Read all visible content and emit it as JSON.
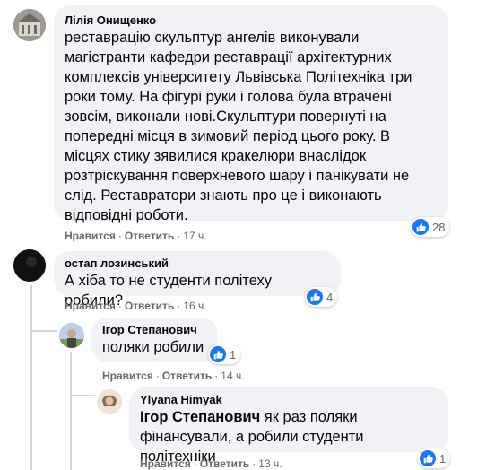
{
  "comments": [
    {
      "author": "Лілія Онищенко",
      "lines": [
        "реставрацію скульптур ангелів виконували",
        "магістранти кафедри реставрації архітектурних",
        "комплексів університету Львівська Політехніка три",
        "роки тому. На фігурі руки і голова була втрачені",
        "зовсім, виконали нові.Скульптури повернуті на",
        "попередні місця в зимовий період цього року. В",
        "місцях стику зявилися кракелюри внаслідок",
        "розтріскування поверхневого шару і панікувати не",
        "слід. Реставратори знають про це і виконають",
        "відповідні роботи."
      ],
      "likes": "28",
      "like_label": "Нравится",
      "reply_label": "Ответить",
      "time": "17 ч."
    },
    {
      "author": "остап лозинський",
      "lines": [
        "А хіба то не студенти політеху робили?"
      ],
      "likes": "4",
      "like_label": "Нравится",
      "reply_label": "Ответить",
      "time": "16 ч."
    },
    {
      "author": "Ігор Степанович",
      "lines": [
        "поляки робили"
      ],
      "likes": "1",
      "like_label": "Нравится",
      "reply_label": "Ответить",
      "time": "14 ч."
    },
    {
      "author": "Ylyana Himyak",
      "mention": "Ігор Степанович",
      "line1_rest": " як раз поляки",
      "line2": "фінансували, а робили студенти політехніки",
      "likes": "1",
      "like_label": "Нравится",
      "reply_label": "Ответить",
      "time": "13 ч."
    }
  ],
  "icons": {
    "reaction": "thumbs-up-icon"
  },
  "colors": {
    "bubble": "#f0f2f5",
    "like": "#1877f2",
    "meta": "#65676b"
  }
}
